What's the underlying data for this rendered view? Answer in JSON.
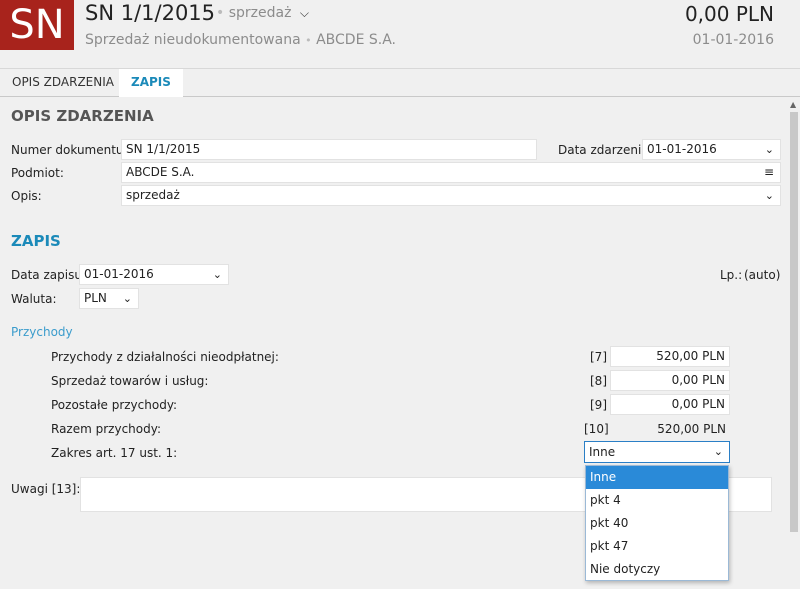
{
  "header": {
    "badge": "SN",
    "title": "SN 1/1/2015",
    "type": "sprzedaż",
    "subtitle": "Sprzedaż nieudokumentowana",
    "company": "ABCDE S.A.",
    "amount": "0,00 PLN",
    "date": "01-01-2016",
    "separator": "•"
  },
  "tabs": [
    {
      "label": "OPIS ZDARZENIA"
    },
    {
      "label": "ZAPIS"
    }
  ],
  "opis": {
    "title": "OPIS ZDARZENIA",
    "numer_label": "Numer dokumentu:",
    "numer_value": "SN 1/1/2015",
    "data_zdarzenia_label": "Data zdarzenia:",
    "data_zdarzenia_value": "01-01-2016",
    "podmiot_label": "Podmiot:",
    "podmiot_value": "ABCDE S.A.",
    "opis_label": "Opis:",
    "opis_value": "sprzedaż"
  },
  "zapis": {
    "title": "ZAPIS",
    "data_label": "Data zapisu:",
    "data_value": "01-01-2016",
    "waluta_label": "Waluta:",
    "waluta_value": "PLN",
    "lp_label": "Lp.:",
    "lp_value": "(auto)"
  },
  "przychody": {
    "title": "Przychody",
    "rows": [
      {
        "label": "Przychody z działalności nieodpłatnej:",
        "code": "[7]",
        "value": "520,00 PLN"
      },
      {
        "label": "Sprzedaż towarów i usług:",
        "code": "[8]",
        "value": "0,00 PLN"
      },
      {
        "label": "Pozostałe przychody:",
        "code": "[9]",
        "value": "0,00 PLN"
      },
      {
        "label": "Razem przychody:",
        "code": "[10]",
        "value": "520,00 PLN"
      }
    ],
    "zakres_label": "Zakres art. 17 ust. 1:",
    "zakres_value": "Inne",
    "zakres_options": [
      "Inne",
      "pkt 4",
      "pkt 40",
      "pkt 47",
      "Nie dotyczy"
    ]
  },
  "uwagi": {
    "label": "Uwagi [13]:",
    "value": ""
  },
  "icons": {
    "chevron": "chevron-down-icon",
    "list": "list-icon"
  },
  "colors": {
    "badge": "#a8231c",
    "accent": "#1b8ab9",
    "selected": "#2a8ad8"
  }
}
